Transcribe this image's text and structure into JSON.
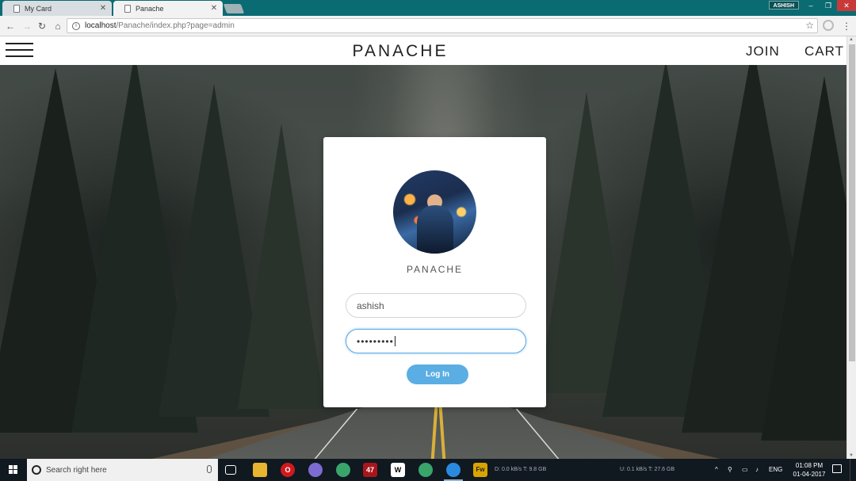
{
  "browser": {
    "tabs": [
      {
        "title": "My Card"
      },
      {
        "title": "Panache"
      }
    ],
    "profile_name": "ASHISH",
    "url_host": "localhost",
    "url_path": "/Panache/index.php?page=admin"
  },
  "site": {
    "brand": "PANACHE",
    "nav": {
      "join": "JOIN",
      "cart": "CART"
    }
  },
  "login": {
    "brand": "PANACHE",
    "username_value": "ashish",
    "password_value": "•••••••••",
    "submit_label": "Log In"
  },
  "taskbar": {
    "search_placeholder": "Search right here",
    "badge_count": "47",
    "net_stats_1": "D: 0.0 kB/s T: 9.8 GB",
    "net_stats_2": "U: 0.1 kB/s T: 27.6 GB",
    "language": "ENG",
    "time": "01:08 PM",
    "date": "01-04-2017"
  },
  "colors": {
    "accent": "#5aaee3",
    "tab_strip": "#0b6b72",
    "taskbar": "#101820"
  }
}
